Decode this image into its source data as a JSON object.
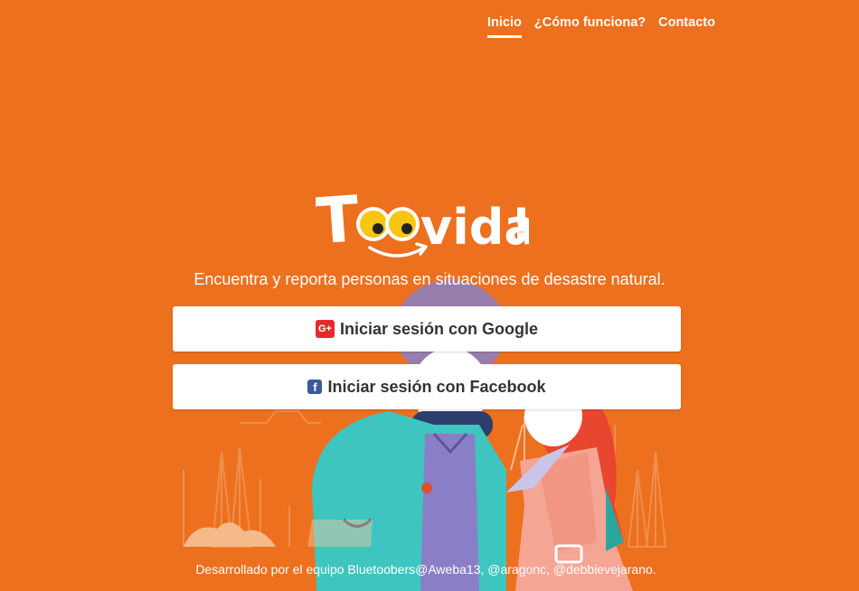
{
  "nav": {
    "items": [
      {
        "label": "Inicio",
        "active": true
      },
      {
        "label": "¿Cómo funciona?",
        "active": false
      },
      {
        "label": "Contacto",
        "active": false
      }
    ]
  },
  "brand": {
    "logo_text": "Toovida!",
    "tagline": "Encuentra y reporta personas en situaciones de desastre natural."
  },
  "auth": {
    "google_label": "Iniciar sesión con Google",
    "google_icon": "google-plus-icon",
    "facebook_label": "Iniciar sesión con Facebook",
    "facebook_icon": "facebook-icon"
  },
  "footer": {
    "text": "Desarrollado por el equipo Bluetoobers@Aweba13, @aragonc, @debbievejarano."
  },
  "colors": {
    "background": "#EC701E",
    "google": "#E42B2B",
    "facebook": "#3B5998"
  }
}
